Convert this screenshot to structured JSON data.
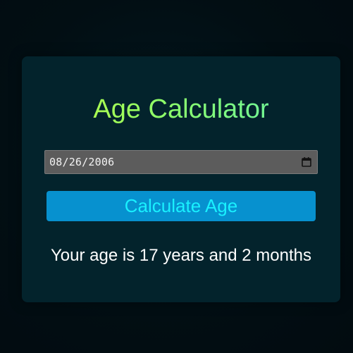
{
  "app": {
    "title": "Age Calculator"
  },
  "form": {
    "birthdate_value": "08/26/2006",
    "calculate_label": "Calculate Age"
  },
  "result": {
    "text": "Your age is 17 years and 2 months"
  },
  "icons": {
    "calendar": "calendar-icon"
  },
  "colors": {
    "background": "#020e13",
    "card": "#03232c",
    "title_gradient_start": "#c6ff3a",
    "title_gradient_end": "#5ff0b0",
    "input_bg": "#5c5c5c",
    "button_bg": "#0791cf",
    "button_text": "#19f0ff",
    "result_text": "#ffffff"
  }
}
